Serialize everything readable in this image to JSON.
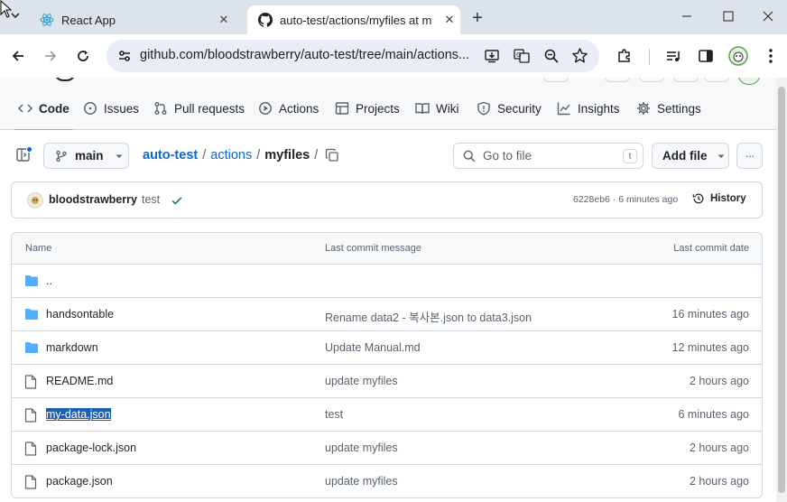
{
  "browser": {
    "tabs": [
      {
        "title": "React App"
      },
      {
        "title": "auto-test/actions/myfiles at m"
      }
    ],
    "new_tab": "+",
    "url": "github.com/bloodstrawberry/auto-test/tree/main/actions...",
    "window_controls": [
      "minimize",
      "maximize",
      "close"
    ]
  },
  "repo_nav": {
    "items": [
      {
        "label": "Code",
        "icon": "code-icon"
      },
      {
        "label": "Issues",
        "icon": "issue-icon"
      },
      {
        "label": "Pull requests",
        "icon": "pull-request-icon"
      },
      {
        "label": "Actions",
        "icon": "play-icon"
      },
      {
        "label": "Projects",
        "icon": "table-icon"
      },
      {
        "label": "Wiki",
        "icon": "book-icon"
      },
      {
        "label": "Security",
        "icon": "shield-icon"
      },
      {
        "label": "Insights",
        "icon": "graph-icon"
      },
      {
        "label": "Settings",
        "icon": "gear-icon"
      }
    ]
  },
  "file_bar": {
    "branch": "main",
    "breadcrumb": [
      "auto-test",
      "actions",
      "myfiles"
    ],
    "separator": "/",
    "search_placeholder": "Go to file",
    "search_shortcut": "t",
    "add_file": "Add file",
    "more": "···"
  },
  "commit": {
    "author": "bloodstrawberry",
    "message": "test",
    "meta": "6228eb6 · 6 minutes ago",
    "history": "History"
  },
  "table": {
    "headers": {
      "name": "Name",
      "message": "Last commit message",
      "date": "Last commit date"
    },
    "rows": [
      {
        "type": "folder",
        "name": "..",
        "message": "",
        "date": ""
      },
      {
        "type": "folder",
        "name": "handsontable",
        "message": "Rename data2 - 복사본.json to data3.json",
        "date": "16 minutes ago"
      },
      {
        "type": "folder",
        "name": "markdown",
        "message": "Update Manual.md",
        "date": "12 minutes ago"
      },
      {
        "type": "file",
        "name": "README.md",
        "message": "update myfiles",
        "date": "2 hours ago"
      },
      {
        "type": "file",
        "name": "my-data.json",
        "message": "test",
        "date": "6 minutes ago",
        "selected": true
      },
      {
        "type": "file",
        "name": "package-lock.json",
        "message": "update myfiles",
        "date": "2 hours ago"
      },
      {
        "type": "file",
        "name": "package.json",
        "message": "update myfiles",
        "date": "2 hours ago"
      }
    ]
  },
  "colors": {
    "accent": "#0969da",
    "folder": "#54aeff",
    "nav_underline": "#fd8c73",
    "success": "#1a7f37",
    "selection": "#1a5fb4"
  }
}
